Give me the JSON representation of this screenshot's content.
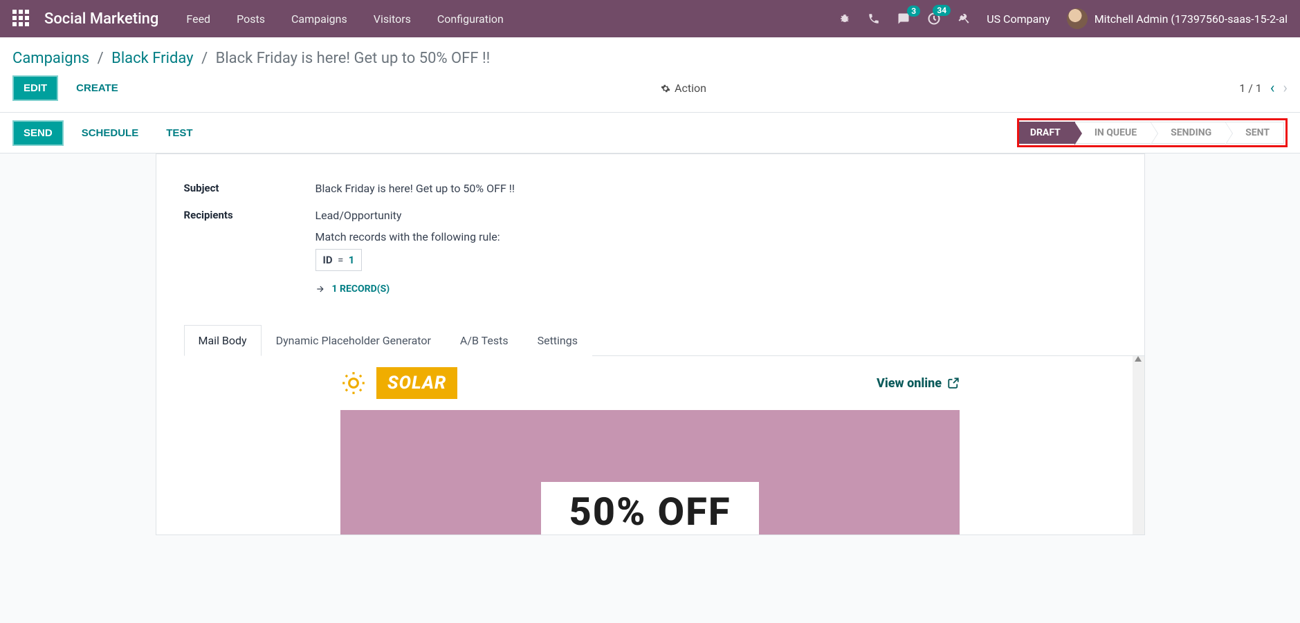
{
  "navbar": {
    "app_title": "Social Marketing",
    "menu": [
      "Feed",
      "Posts",
      "Campaigns",
      "Visitors",
      "Configuration"
    ],
    "badges": {
      "messages": "3",
      "activities": "34"
    },
    "company": "US Company",
    "username": "Mitchell Admin (17397560-saas-15-2-al"
  },
  "breadcrumb": {
    "root": "Campaigns",
    "parent": "Black Friday",
    "current": "Black Friday is here! Get up to 50% OFF !!"
  },
  "buttons": {
    "edit": "EDIT",
    "create": "CREATE",
    "action": "Action",
    "send": "SEND",
    "schedule": "SCHEDULE",
    "test": "TEST"
  },
  "pager": {
    "text": "1 / 1"
  },
  "stages": [
    "DRAFT",
    "IN QUEUE",
    "SENDING",
    "SENT"
  ],
  "active_stage": 0,
  "form": {
    "subject_label": "Subject",
    "subject_value": "Black Friday is here! Get up to 50% OFF !!",
    "recipients_label": "Recipients",
    "recipients_value": "Lead/Opportunity",
    "rule_text": "Match records with the following rule:",
    "rule_field": "ID",
    "rule_op": "=",
    "rule_val": "1",
    "records_link": "1 RECORD(S)"
  },
  "tabs": [
    "Mail Body",
    "Dynamic Placeholder Generator",
    "A/B Tests",
    "Settings"
  ],
  "mailbody": {
    "brand": "SOLAR",
    "view_online": "View online",
    "offer": "50% OFF"
  }
}
